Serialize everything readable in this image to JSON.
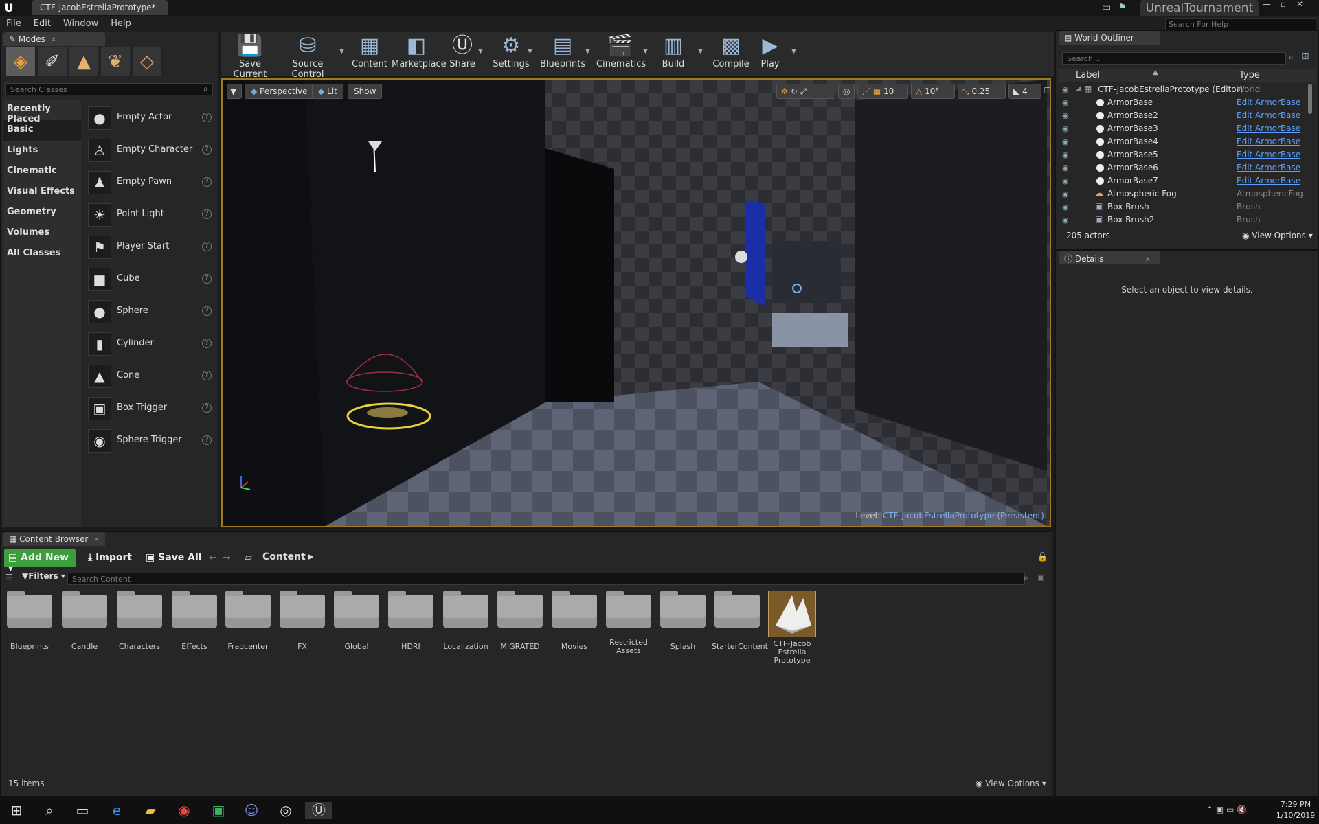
{
  "title_bar": {
    "doc_tab": "CTF-JacobEstrellaPrototype*",
    "project_name": "UnrealTournament"
  },
  "menu": [
    "File",
    "Edit",
    "Window",
    "Help"
  ],
  "help_search": {
    "placeholder": "Search For Help"
  },
  "modes": {
    "tab": "Modes",
    "search_placeholder": "Search Classes",
    "categories": [
      "Recently Placed",
      "Basic",
      "Lights",
      "Cinematic",
      "Visual Effects",
      "Geometry",
      "Volumes",
      "All Classes"
    ],
    "active_category": "Basic",
    "actors": [
      "Empty Actor",
      "Empty Character",
      "Empty Pawn",
      "Point Light",
      "Player Start",
      "Cube",
      "Sphere",
      "Cylinder",
      "Cone",
      "Box Trigger",
      "Sphere Trigger"
    ]
  },
  "toolbar": {
    "save_current": "Save Current",
    "source_control": "Source Control",
    "content": "Content",
    "marketplace": "Marketplace",
    "share": "Share",
    "settings": "Settings",
    "blueprints": "Blueprints",
    "cinematics": "Cinematics",
    "build": "Build",
    "compile": "Compile",
    "play": "Play"
  },
  "viewport": {
    "perspective": "Perspective",
    "lit": "Lit",
    "show": "Show",
    "grid_snap": "10",
    "rotation_snap": "10°",
    "scale_snap": "0.25",
    "camera_speed": "4",
    "level_label": "Level:",
    "level_name": "CTF-JacobEstrellaPrototype (Persistent)"
  },
  "outliner": {
    "tab": "World Outliner",
    "search_placeholder": "Search...",
    "col_label": "Label",
    "col_type": "Type",
    "rows": [
      {
        "label": "CTF-JacobEstrellaPrototype (Editor)",
        "type": "World"
      },
      {
        "label": "ArmorBase",
        "type": "Edit ArmorBase"
      },
      {
        "label": "ArmorBase2",
        "type": "Edit ArmorBase"
      },
      {
        "label": "ArmorBase3",
        "type": "Edit ArmorBase"
      },
      {
        "label": "ArmorBase4",
        "type": "Edit ArmorBase"
      },
      {
        "label": "ArmorBase5",
        "type": "Edit ArmorBase"
      },
      {
        "label": "ArmorBase6",
        "type": "Edit ArmorBase"
      },
      {
        "label": "ArmorBase7",
        "type": "Edit ArmorBase"
      },
      {
        "label": "Atmospheric Fog",
        "type": "AtmosphericFog"
      },
      {
        "label": "Box Brush",
        "type": "Brush"
      },
      {
        "label": "Box Brush2",
        "type": "Brush"
      }
    ],
    "actor_count": "205 actors",
    "view_options": "View Options"
  },
  "details": {
    "tab": "Details",
    "empty_message": "Select an object to view details."
  },
  "content_browser": {
    "tab": "Content Browser",
    "add_new": "Add New",
    "import": "Import",
    "save_all": "Save All",
    "path": "Content",
    "filters": "Filters",
    "search_placeholder": "Search Content",
    "folders": [
      "Blueprints",
      "Candle",
      "Characters",
      "Effects",
      "Fragcenter",
      "FX",
      "Global",
      "HDRI",
      "Localization",
      "MIGRATED",
      "Movies",
      "Restricted Assets",
      "Splash",
      "StarterContent"
    ],
    "asset": "CTF-Jacob Estrella Prototype",
    "item_count": "15 items",
    "view_options": "View Options"
  },
  "taskbar": {
    "time": "7:29 PM",
    "date": "1/10/2019"
  }
}
